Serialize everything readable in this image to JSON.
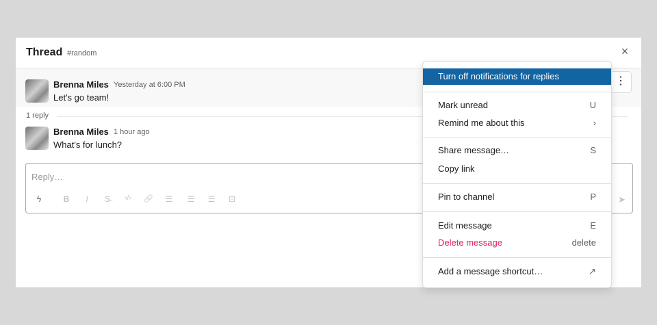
{
  "thread": {
    "title": "Thread",
    "channel": "#random",
    "close_glyph": "×"
  },
  "messages": [
    {
      "author": "Brenna Miles",
      "time": "Yesterday at 6:00 PM",
      "text": "Let's go team!"
    },
    {
      "author": "Brenna Miles",
      "time": "1 hour ago",
      "text": "What's for lunch?"
    }
  ],
  "reply_count": "1 reply",
  "more_glyph": "⋮",
  "composer": {
    "placeholder": "Reply…",
    "tools": {
      "shortcuts": "ϟ",
      "bold": "B",
      "italic": "I",
      "strike": "S̶",
      "code": "‹/›",
      "link": "🔗",
      "ordered_list": "☰",
      "bulleted_list": "☰",
      "blockquote": "☰",
      "code_block": "⊡"
    },
    "send_glyph": "➤"
  },
  "menu": {
    "items": [
      {
        "label": "Turn off notifications for replies",
        "shortcut": ""
      },
      {
        "label": "Mark unread",
        "shortcut": "U"
      },
      {
        "label": "Remind me about this",
        "shortcut": "›"
      },
      {
        "label": "Share message…",
        "shortcut": "S"
      },
      {
        "label": "Copy link",
        "shortcut": ""
      },
      {
        "label": "Pin to channel",
        "shortcut": "P"
      },
      {
        "label": "Edit message",
        "shortcut": "E"
      },
      {
        "label": "Delete message",
        "shortcut": "delete"
      },
      {
        "label": "Add a message shortcut…",
        "shortcut": "↗"
      }
    ]
  },
  "colors": {
    "active_item": "#1264a3",
    "danger": "#e01e5a",
    "background": "#d8d8d8"
  }
}
